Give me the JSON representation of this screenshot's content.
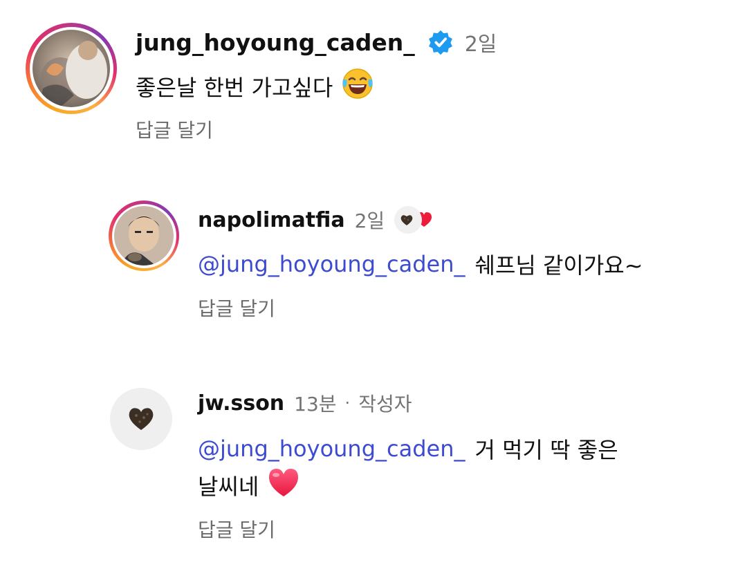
{
  "comments": [
    {
      "username": "jung_hoyoung_caden_",
      "verified": true,
      "time": "2일",
      "text": "좋은날 한번 가고싶다",
      "emoji": "laughing-tears-emoji",
      "reply_label": "답글 달기"
    },
    {
      "username": "napolimatfia",
      "time": "2일",
      "mention": "@jung_hoyoung_caden_",
      "text": "쉐프님 같이가요~",
      "reaction_icons": [
        "truffle-icon",
        "red-heart-icon"
      ],
      "reply_label": "답글 달기"
    },
    {
      "username": "jw.sson",
      "time": "13분",
      "separator": "·",
      "author_badge": "작성자",
      "mention": "@jung_hoyoung_caden_",
      "text_line1": "거 먹기 딱 좋은",
      "text_line2": "날씨네",
      "emoji": "heart-emoji",
      "reply_label": "답글 달기"
    }
  ],
  "colors": {
    "mention": "#3d4bd1",
    "meta": "#737373",
    "verified": "#1d9bf0",
    "heart": "#ed1c3a"
  }
}
